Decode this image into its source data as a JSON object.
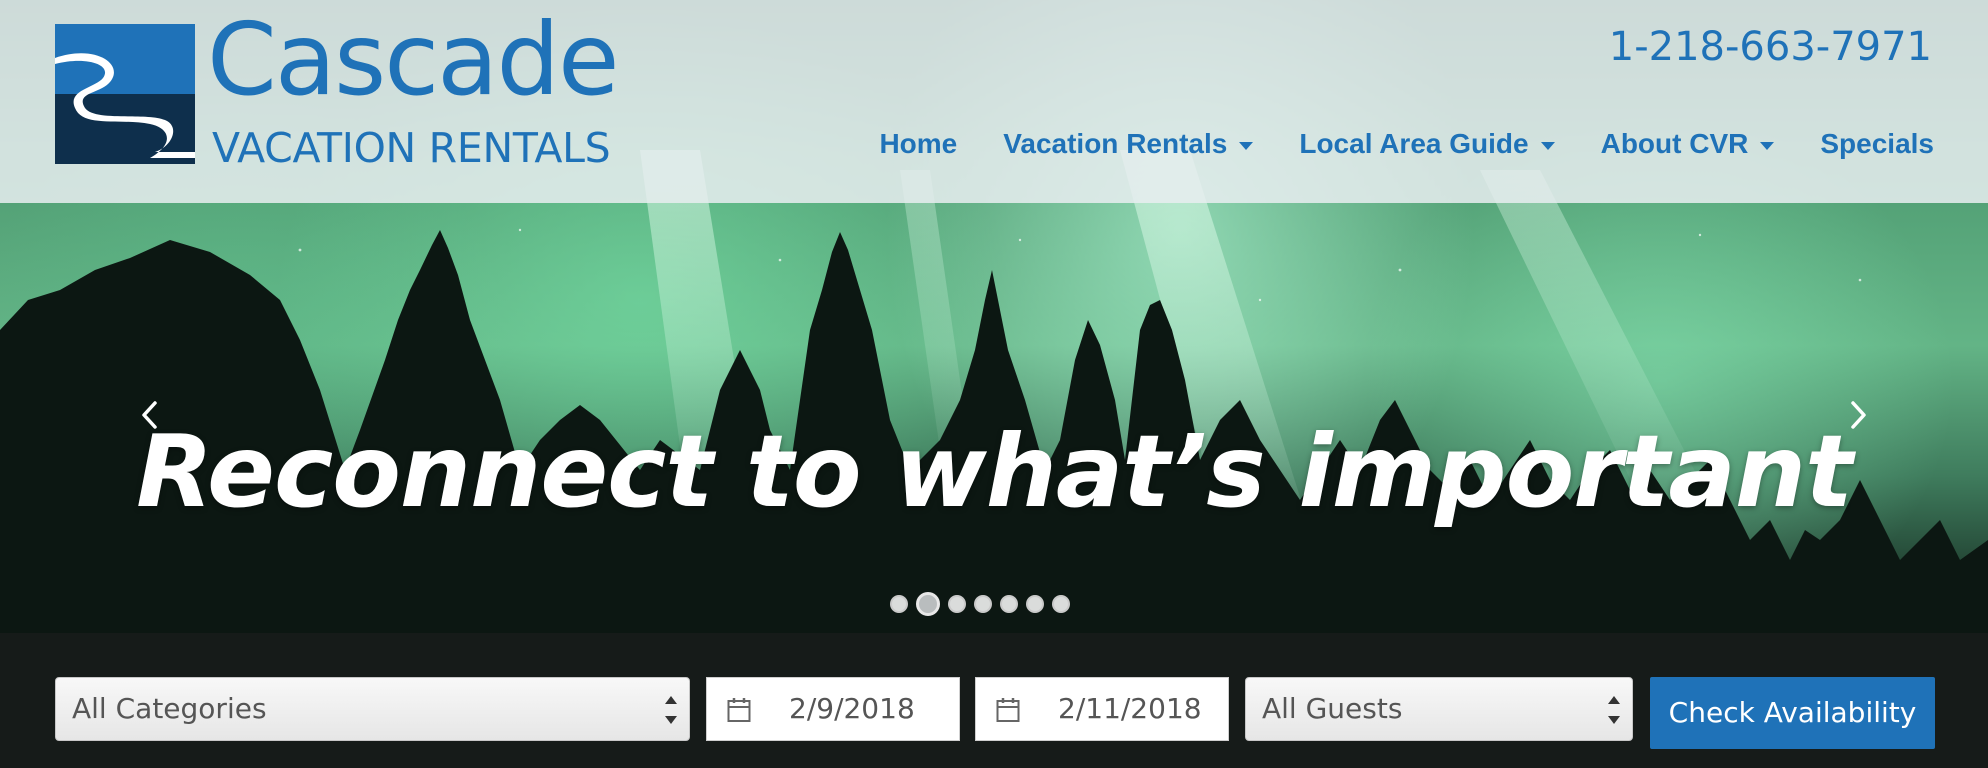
{
  "brand": {
    "name": "Cascade",
    "subtitle": "VACATION RENTALS",
    "phone": "1-218-663-7971",
    "color": "#1f72b8"
  },
  "nav": {
    "items": [
      {
        "label": "Home",
        "dropdown": false
      },
      {
        "label": "Vacation Rentals",
        "dropdown": true
      },
      {
        "label": "Local Area Guide",
        "dropdown": true
      },
      {
        "label": "About CVR",
        "dropdown": true
      },
      {
        "label": "Specials",
        "dropdown": false
      }
    ]
  },
  "hero": {
    "tagline": "Reconnect to what’s important",
    "slide_count": 7,
    "active_slide": 2,
    "prev_icon": "chevron-left-icon",
    "next_icon": "chevron-right-icon"
  },
  "search": {
    "category": "All Categories",
    "arrival": "2/9/2018",
    "departure": "2/11/2018",
    "guests": "All Guests",
    "button_label": "Check Availability"
  }
}
